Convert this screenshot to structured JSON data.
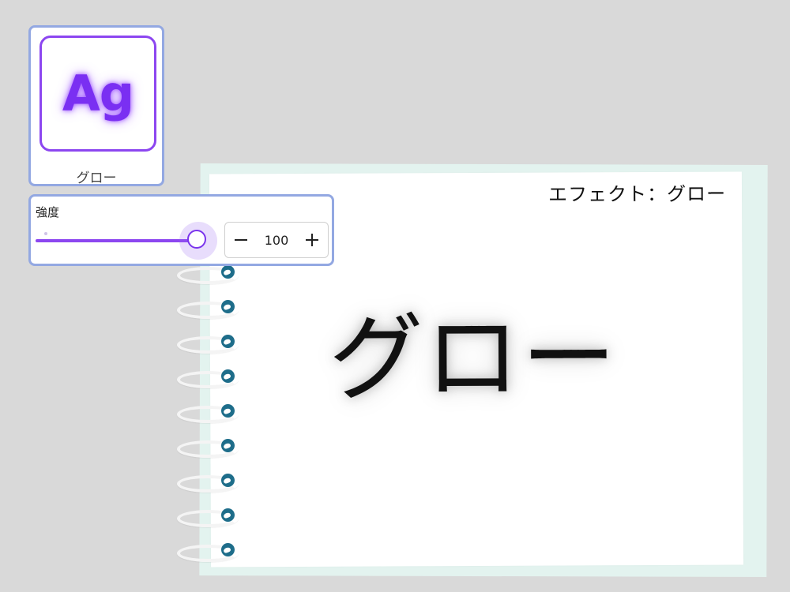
{
  "effect_tile": {
    "preview_text": "Ag",
    "label": "グロー",
    "accent_color": "#8c46f0",
    "border_color": "#93a8e2"
  },
  "intensity": {
    "label": "強度",
    "value": "100",
    "slider_percent": 100,
    "decrement_icon": "minus-icon",
    "increment_icon": "plus-icon"
  },
  "notebook": {
    "label": "エフェクト：グロー",
    "sample_text": "グロー",
    "spiral_count": 11,
    "page_color": "#ffffff",
    "back_color": "#e3f3ef",
    "hole_color": "#1e6d8a"
  }
}
